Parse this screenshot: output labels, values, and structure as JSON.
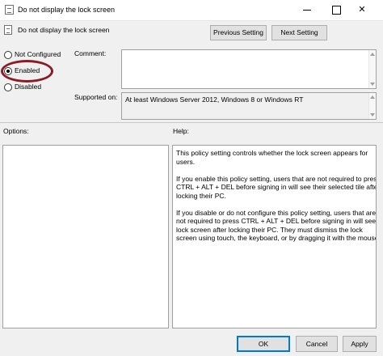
{
  "window": {
    "title": "Do not display the lock screen"
  },
  "header": {
    "title": "Do not display the lock screen",
    "previous_label": "Previous Setting",
    "next_label": "Next Setting"
  },
  "radio": {
    "options": [
      "Not Configured",
      "Enabled",
      "Disabled"
    ],
    "selected": "Enabled"
  },
  "comment": {
    "label": "Comment:",
    "value": ""
  },
  "supported": {
    "label": "Supported on:",
    "value": "At least Windows Server 2012, Windows 8 or Windows RT"
  },
  "options": {
    "label": "Options:"
  },
  "help": {
    "label": "Help:",
    "paragraphs": [
      "This policy setting controls whether the lock screen appears for users.",
      "If you enable this policy setting, users that are not required to press CTRL + ALT + DEL before signing in will see their selected tile after locking their PC.",
      "If you disable or do not configure this policy setting, users that are not required to press CTRL + ALT + DEL before signing in will see a lock screen after locking their PC. They must dismiss the lock screen using touch, the keyboard, or by dragging it with the mouse."
    ]
  },
  "footer": {
    "ok_label": "OK",
    "cancel_label": "Cancel",
    "apply_label": "Apply"
  },
  "colors": {
    "annotation_ellipse": "#8a1c25",
    "ok_border": "#0078d7"
  }
}
